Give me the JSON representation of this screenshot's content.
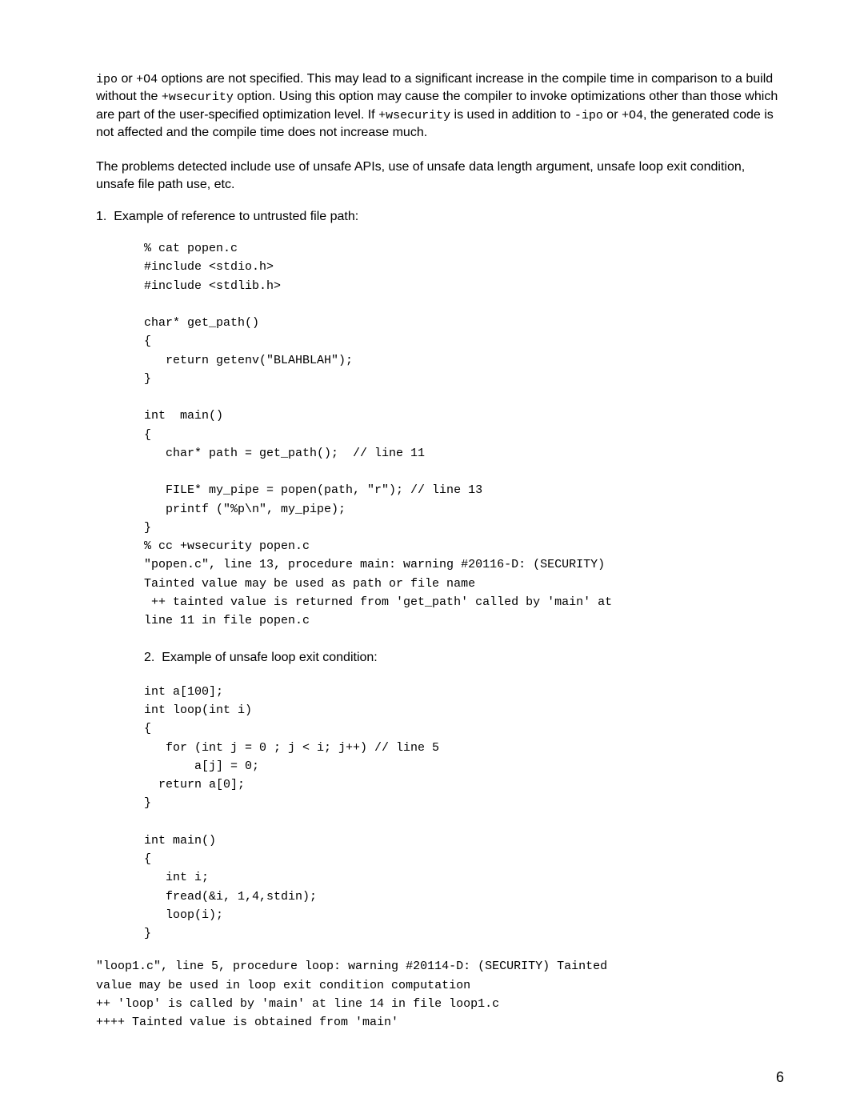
{
  "intro": {
    "p1_a": "ipo",
    "p1_b": " or ",
    "p1_c": "+O4",
    "p1_d": " options are not specified. This may lead to a significant increase in the compile time in comparison to a build without the ",
    "p1_e": "+wsecurity",
    "p1_f": " option. Using this option may cause the compiler to invoke optimizations other than those which are part of the user-specified optimization level. If ",
    "p1_g": "+wsecurity",
    "p1_h": " is used in addition to ",
    "p1_i": "-ipo",
    "p1_j": " or ",
    "p1_k": "+O4",
    "p1_l": ", the generated code is not affected and the compile time does not increase much.",
    "p2": "The problems detected include use of unsafe APIs, use of unsafe data length argument, unsafe loop exit condition, unsafe file path use, etc."
  },
  "list": {
    "item1_marker": "1.",
    "item1_text": "Example of  reference to untrusted file path:",
    "item2_marker": "2.",
    "item2_text": "Example of unsafe loop exit condition:"
  },
  "code1": "% cat popen.c\n#include <stdio.h>\n#include <stdlib.h>\n\nchar* get_path()\n{\n   return getenv(\"BLAHBLAH\");\n}\n\nint  main()\n{\n   char* path = get_path();  // line 11\n\n   FILE* my_pipe = popen(path, \"r\"); // line 13\n   printf (\"%p\\n\", my_pipe);\n}\n% cc +wsecurity popen.c\n\"popen.c\", line 13, procedure main: warning #20116-D: (SECURITY)\nTainted value may be used as path or file name\n ++ tainted value is returned from 'get_path' called by 'main' at\nline 11 in file popen.c",
  "code2": "int a[100];\nint loop(int i)\n{\n   for (int j = 0 ; j < i; j++) // line 5\n       a[j] = 0;\n  return a[0];\n}\n\nint main()\n{\n   int i;\n   fread(&i, 1,4,stdin);\n   loop(i);\n}",
  "code3": "\"loop1.c\", line 5, procedure loop: warning #20114-D: (SECURITY) Tainted\nvalue may be used in loop exit condition computation\n++ 'loop' is called by 'main' at line 14 in file loop1.c\n++++ Tainted value is obtained from 'main'",
  "page_number": "6"
}
